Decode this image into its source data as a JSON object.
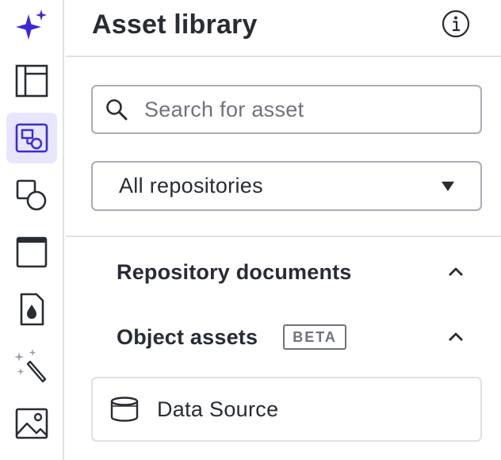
{
  "rail": {
    "items": [
      {
        "icon": "sparkle-icon",
        "name": "AI assist"
      },
      {
        "icon": "layout-icon",
        "name": "Templates"
      },
      {
        "icon": "asset-library-icon",
        "name": "Asset library",
        "active": true
      },
      {
        "icon": "shapes-icon",
        "name": "Shapes"
      },
      {
        "icon": "frame-icon",
        "name": "Frames"
      },
      {
        "icon": "color-drop-icon",
        "name": "Colors"
      },
      {
        "icon": "magic-wand-icon",
        "name": "Magic"
      },
      {
        "icon": "image-icon",
        "name": "Images"
      }
    ],
    "accent": "#3b2ad4",
    "active_bg": "#e8e6fc"
  },
  "panel": {
    "title": "Asset library",
    "search": {
      "placeholder": "Search for asset",
      "value": ""
    },
    "repository_select": {
      "value": "All repositories"
    },
    "sections": [
      {
        "title": "Repository documents",
        "expanded": true
      },
      {
        "title": "Object assets",
        "badge": "BETA",
        "expanded": true
      }
    ],
    "assets": [
      {
        "label": "Data Source",
        "icon": "database-icon"
      }
    ]
  }
}
